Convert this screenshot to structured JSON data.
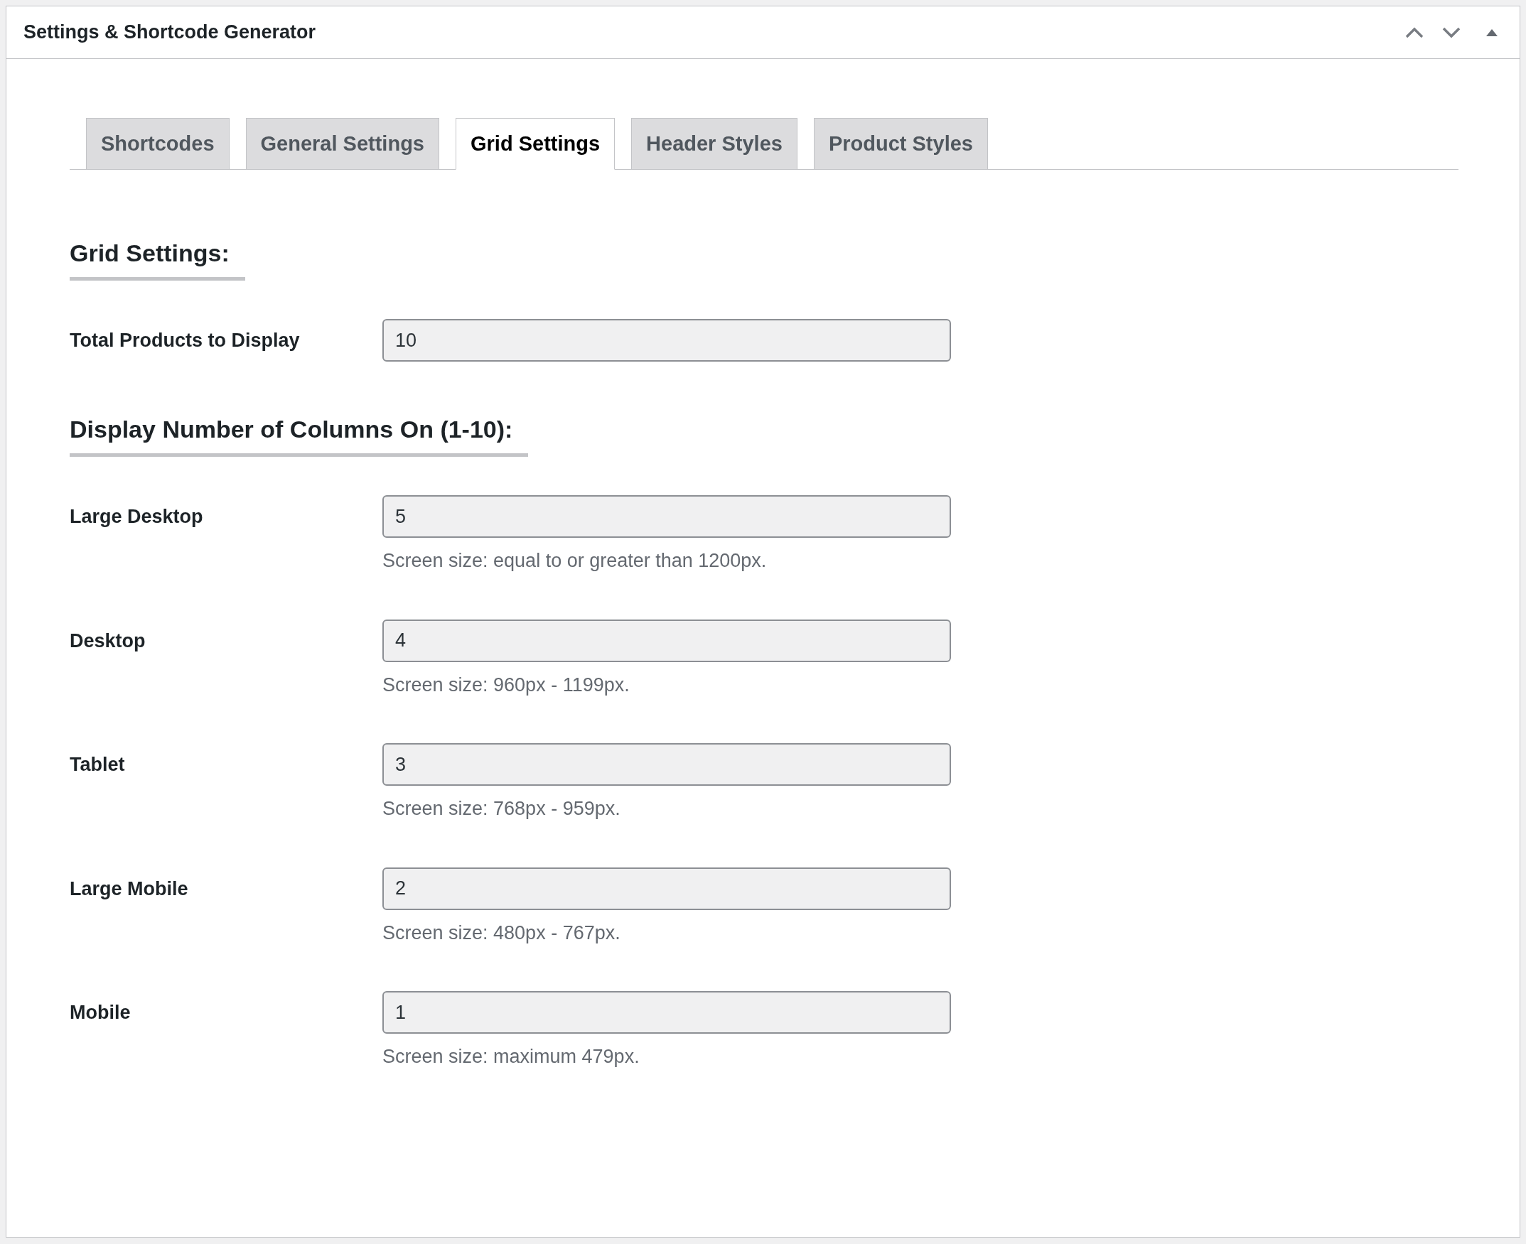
{
  "panel": {
    "title": "Settings & Shortcode Generator"
  },
  "tabs": [
    {
      "label": "Shortcodes",
      "selected": false
    },
    {
      "label": "General Settings",
      "selected": false
    },
    {
      "label": "Grid Settings",
      "selected": true
    },
    {
      "label": "Header Styles",
      "selected": false
    },
    {
      "label": "Product Styles",
      "selected": false
    }
  ],
  "sections": [
    {
      "heading": "Grid Settings:",
      "fields": [
        {
          "label": "Total Products to Display",
          "value": "10"
        }
      ]
    },
    {
      "heading": "Display Number of Columns On (1-10):",
      "fields": [
        {
          "label": "Large Desktop",
          "value": "5",
          "hint": "Screen size: equal to or greater than 1200px."
        },
        {
          "label": "Desktop",
          "value": "4",
          "hint": "Screen size: 960px - 1199px."
        },
        {
          "label": "Tablet",
          "value": "3",
          "hint": "Screen size: 768px - 959px."
        },
        {
          "label": "Large Mobile",
          "value": "2",
          "hint": "Screen size: 480px - 767px."
        },
        {
          "label": "Mobile",
          "value": "1",
          "hint": "Screen size: maximum 479px."
        }
      ]
    }
  ]
}
